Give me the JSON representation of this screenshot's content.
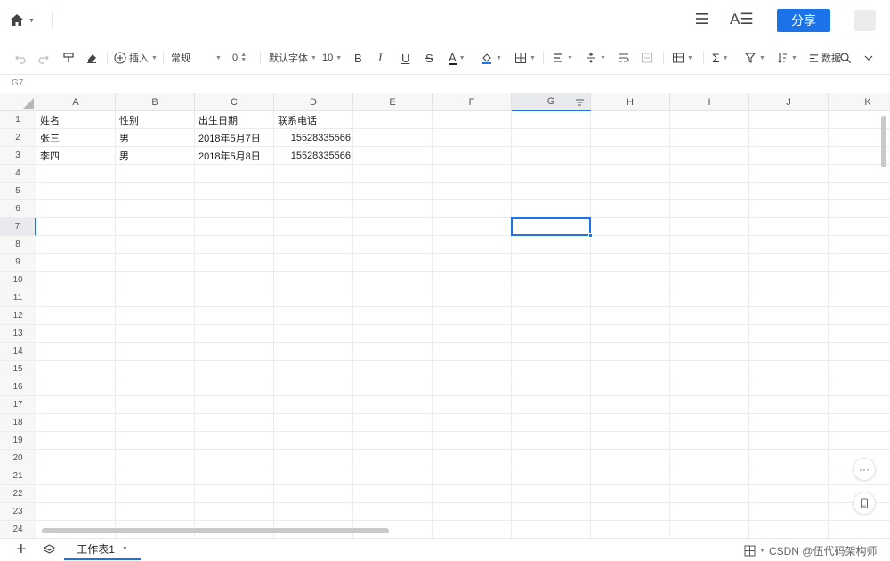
{
  "topbar": {
    "share_label": "分享",
    "font_icon_text": "A☰"
  },
  "toolbar": {
    "insert_label": "插入",
    "format_label": "常规",
    "decimal_label": ".0",
    "font_label": "默认字体",
    "size_label": "10",
    "bold_label": "B",
    "italic_label": "I",
    "underline_label": "U",
    "strike_label": "S",
    "color_label": "A",
    "data_label": "数据"
  },
  "formula": {
    "cell_ref": "G7"
  },
  "columns": [
    "A",
    "B",
    "C",
    "D",
    "E",
    "F",
    "G",
    "H",
    "I",
    "J",
    "K"
  ],
  "selected_column": "G",
  "selected_row": 7,
  "rows": [
    "1",
    "2",
    "3",
    "4",
    "5",
    "6",
    "7",
    "8",
    "9",
    "10",
    "11",
    "12",
    "13",
    "14",
    "15",
    "16",
    "17",
    "18",
    "19",
    "20",
    "21",
    "22",
    "23",
    "24"
  ],
  "cells": [
    {
      "ref": "A1",
      "value": "姓名"
    },
    {
      "ref": "B1",
      "value": "性别"
    },
    {
      "ref": "C1",
      "value": "出生日期"
    },
    {
      "ref": "D1",
      "value": "联系电话"
    },
    {
      "ref": "A2",
      "value": "张三"
    },
    {
      "ref": "B2",
      "value": "男"
    },
    {
      "ref": "C2",
      "value": "2018年5月7日"
    },
    {
      "ref": "D2",
      "value": "15528335566",
      "numeric": true
    },
    {
      "ref": "A3",
      "value": "李四"
    },
    {
      "ref": "B3",
      "value": "男"
    },
    {
      "ref": "C3",
      "value": "2018年5月8日"
    },
    {
      "ref": "D3",
      "value": "15528335566",
      "numeric": true
    }
  ],
  "floating": {
    "more_label": "···"
  },
  "sheet": {
    "tab_label": "工作表1"
  },
  "watermark": "CSDN @伍代码架构师",
  "colors": {
    "accent": "#1a73e8"
  }
}
